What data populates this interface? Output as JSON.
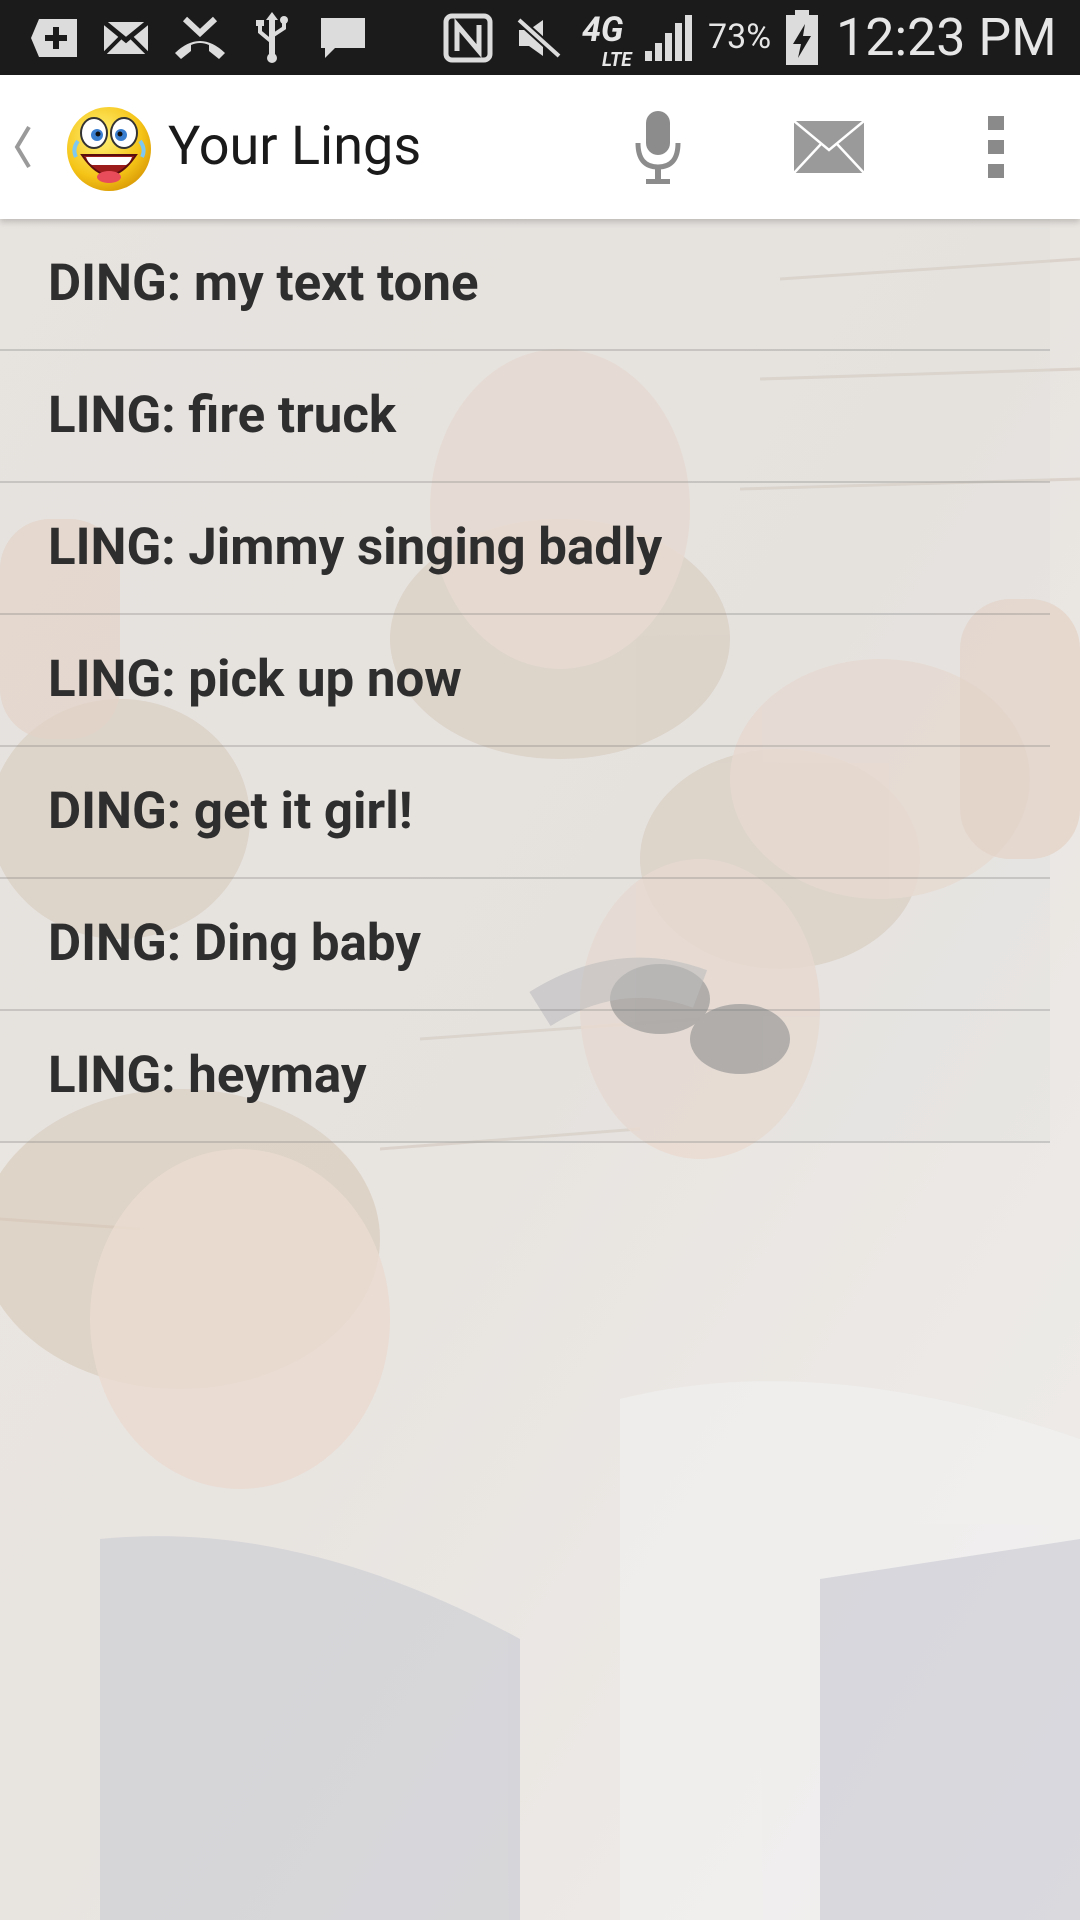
{
  "status_bar": {
    "battery_percent": "73%",
    "network_type": "4G",
    "network_sub": "LTE",
    "time": "12:23 PM",
    "icons": [
      "add-notification-icon",
      "mail-icon",
      "missed-call-icon",
      "usb-icon",
      "chat-icon",
      "nfc-icon",
      "mute-icon",
      "signal-icon",
      "battery-charging-icon"
    ]
  },
  "action_bar": {
    "title": "Your Lings",
    "icons": [
      "back-chevron-icon",
      "app-logo-icon",
      "microphone-icon",
      "envelope-icon",
      "overflow-menu-icon"
    ]
  },
  "lings": [
    {
      "label": "DING: my text tone"
    },
    {
      "label": "LING: fire truck"
    },
    {
      "label": "LING: Jimmy singing badly"
    },
    {
      "label": "LING: pick up now"
    },
    {
      "label": "DING: get it girl!"
    },
    {
      "label": "DING: Ding baby"
    },
    {
      "label": "LING: heymay"
    }
  ],
  "colors": {
    "status_bar_bg": "#1b1b1b",
    "action_bar_bg": "#ffffff",
    "list_text": "#2e2e2e"
  }
}
